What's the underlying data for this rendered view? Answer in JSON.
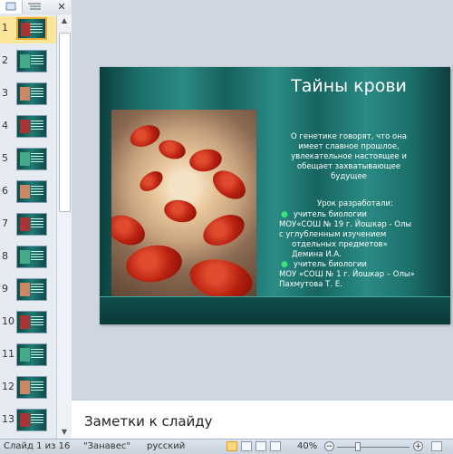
{
  "thumbnails": {
    "slides": [
      {
        "number": "1"
      },
      {
        "number": "2"
      },
      {
        "number": "3"
      },
      {
        "number": "4"
      },
      {
        "number": "5"
      },
      {
        "number": "6"
      },
      {
        "number": "7"
      },
      {
        "number": "8"
      },
      {
        "number": "9"
      },
      {
        "number": "10"
      },
      {
        "number": "11"
      },
      {
        "number": "12"
      },
      {
        "number": "13"
      }
    ],
    "active_index": 0
  },
  "slide": {
    "title": "Тайны крови",
    "quote_lines": [
      "О генетике говорят, что она",
      "имеет славное прошлое,",
      "увлекательное настоящее и",
      "обещает захватывающее",
      "будущее"
    ],
    "credits_head": "Урок разработали:",
    "credit1_role": "учитель биологии",
    "credit1_lines": [
      "МОУ«СОШ № 19 г. Йошкар - Олы",
      "с углубленным изучением",
      "отдельных предметов»",
      "Демина И.А."
    ],
    "credit2_role": "учитель биологии",
    "credit2_lines": [
      "МОУ «СОШ № 1 г. Йошкар – Олы»",
      "Пахмутова Т. Е."
    ]
  },
  "notes": {
    "placeholder": "Заметки к слайду"
  },
  "status": {
    "slide_info": "Слайд 1 из 16",
    "theme": "\"Занавес\"",
    "language": "русский",
    "zoom": "40%",
    "zoom_minus": "−",
    "zoom_plus": "+"
  },
  "colors": {
    "accent_active": "#fde69a",
    "slide_bg": "#1d716c",
    "bullet": "#39e57a"
  }
}
